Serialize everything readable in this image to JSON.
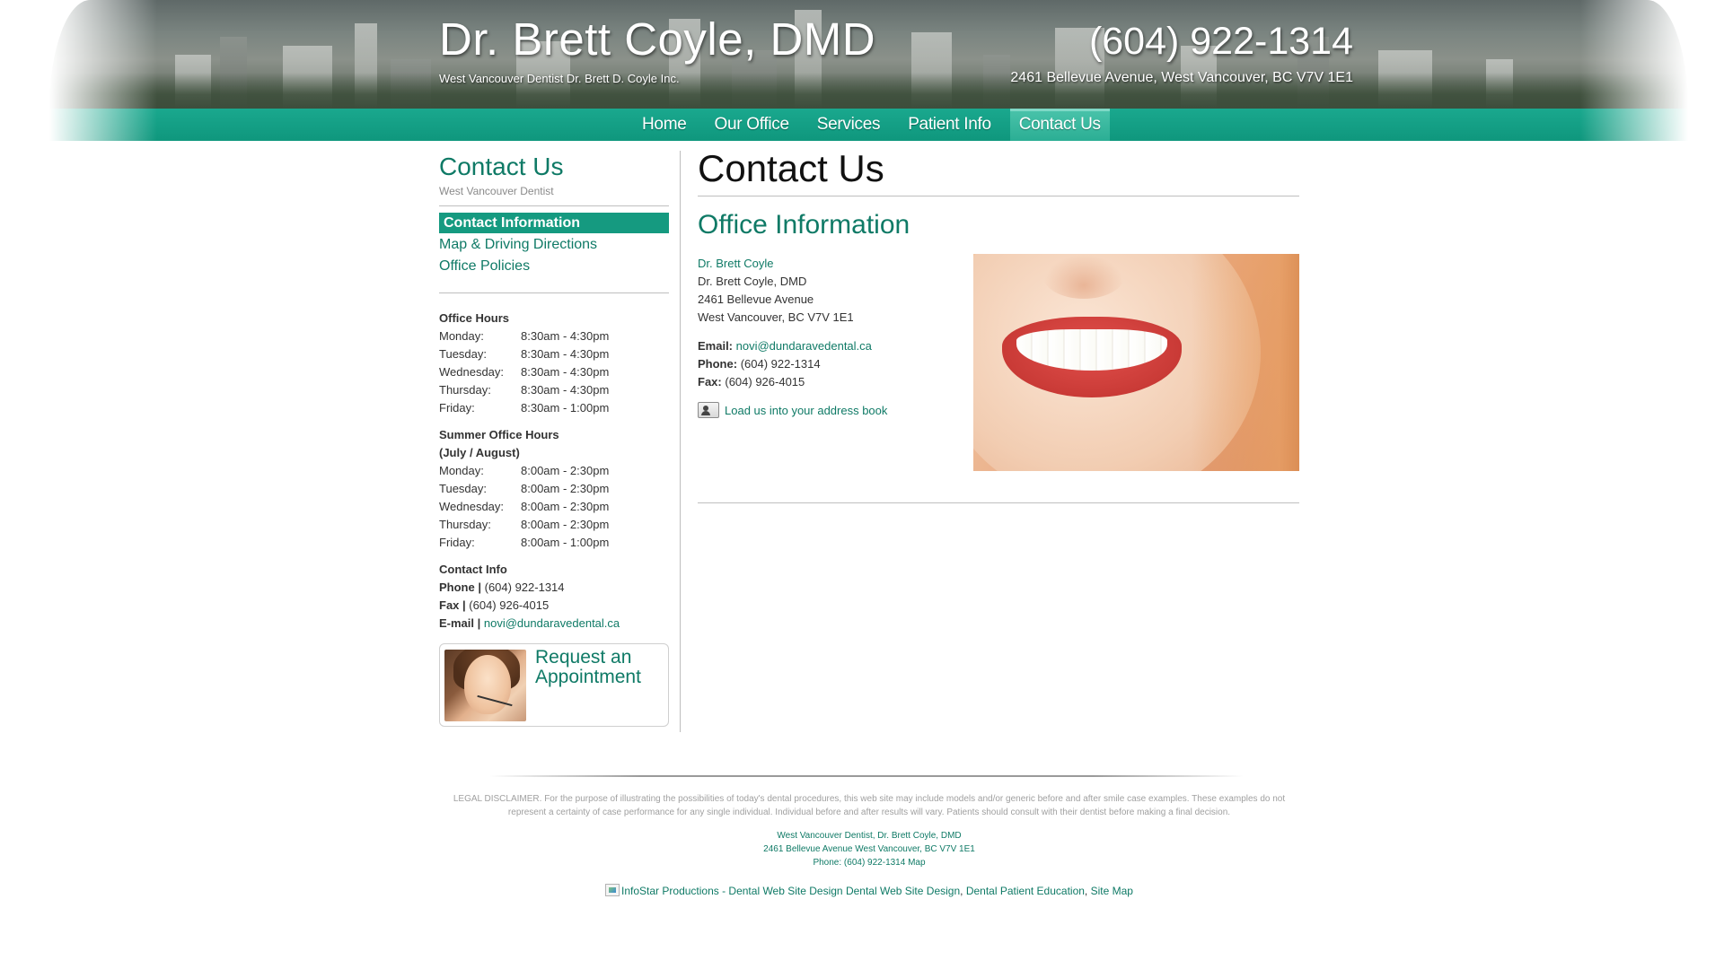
{
  "header": {
    "title": "Dr. Brett Coyle, DMD",
    "subtitle": "West Vancouver Dentist Dr. Brett D. Coyle Inc.",
    "phone": "(604) 922-1314",
    "address": "2461 Bellevue Avenue, West Vancouver, BC V7V 1E1"
  },
  "nav": {
    "items": [
      {
        "label": "Home"
      },
      {
        "label": "Our Office"
      },
      {
        "label": "Services"
      },
      {
        "label": "Patient Info"
      },
      {
        "label": "Contact Us"
      }
    ],
    "active": "Contact Us"
  },
  "sidebar": {
    "title": "Contact Us",
    "subtitle": "West Vancouver Dentist",
    "menu": [
      {
        "label": "Contact Information"
      },
      {
        "label": "Map & Driving Directions"
      },
      {
        "label": "Office Policies"
      }
    ],
    "office_hours_heading": "Office Hours",
    "office_hours": [
      {
        "day": "Monday:",
        "hours": "8:30am - 4:30pm"
      },
      {
        "day": "Tuesday:",
        "hours": "8:30am - 4:30pm"
      },
      {
        "day": "Wednesday:",
        "hours": "8:30am - 4:30pm"
      },
      {
        "day": "Thursday:",
        "hours": "8:30am - 4:30pm"
      },
      {
        "day": "Friday:",
        "hours": "8:30am - 1:00pm"
      }
    ],
    "summer_heading_1": "Summer Office Hours",
    "summer_heading_2": "(July / August)",
    "summer_hours": [
      {
        "day": "Monday:",
        "hours": "8:00am - 2:30pm"
      },
      {
        "day": "Tuesday:",
        "hours": "8:00am - 2:30pm"
      },
      {
        "day": "Wednesday:",
        "hours": "8:00am - 2:30pm"
      },
      {
        "day": "Thursday:",
        "hours": "8:00am - 2:30pm"
      },
      {
        "day": "Friday:",
        "hours": "8:00am - 1:00pm"
      }
    ],
    "contact_heading": "Contact Info",
    "phone_label": "Phone |",
    "phone": "(604) 922-1314",
    "fax_label": "Fax |",
    "fax": "(604) 926-4015",
    "email_label": "E-mail |",
    "email": "novi@dundaravedental.ca",
    "appointment": "Request an Appointment"
  },
  "main": {
    "title": "Contact Us",
    "section_title": "Office Information",
    "name_link": "Dr. Brett Coyle",
    "lines": [
      "Dr. Brett Coyle, DMD",
      "2461 Bellevue Avenue",
      "West Vancouver, BC V7V 1E1"
    ],
    "email_label": "Email:",
    "email": "novi@dundaravedental.ca",
    "phone_label": "Phone:",
    "phone": "(604) 922-1314",
    "fax_label": "Fax:",
    "fax": "(604) 926-4015",
    "vcard_label": "Load us into your address book"
  },
  "footer": {
    "disclaimer": "LEGAL DISCLAIMER. For the purpose of illustrating the possibilities of today's dental procedures, this web site may include models and/or generic before and after smile case examples. These examples do not represent a certainty of case performance for any single individual. Individual before and after results will vary. Patients should consult with their dentist before making a final decision.",
    "info_line_1": "West Vancouver Dentist, Dr. Brett Coyle, DMD",
    "info_line_2": "2461 Bellevue Avenue West Vancouver, BC V7V 1E1",
    "info_phone": "Phone: (604) 922-1314",
    "info_map": "Map",
    "logo_alt": "InfoStar Productions - Dental Web Site Design",
    "link_1": "Dental Web Site Design",
    "link_2": "Dental Patient Education",
    "link_3": "Site Map",
    "sep": ","
  },
  "colors": {
    "brand_green": "#0f7a66",
    "nav_green": "#159a80"
  }
}
